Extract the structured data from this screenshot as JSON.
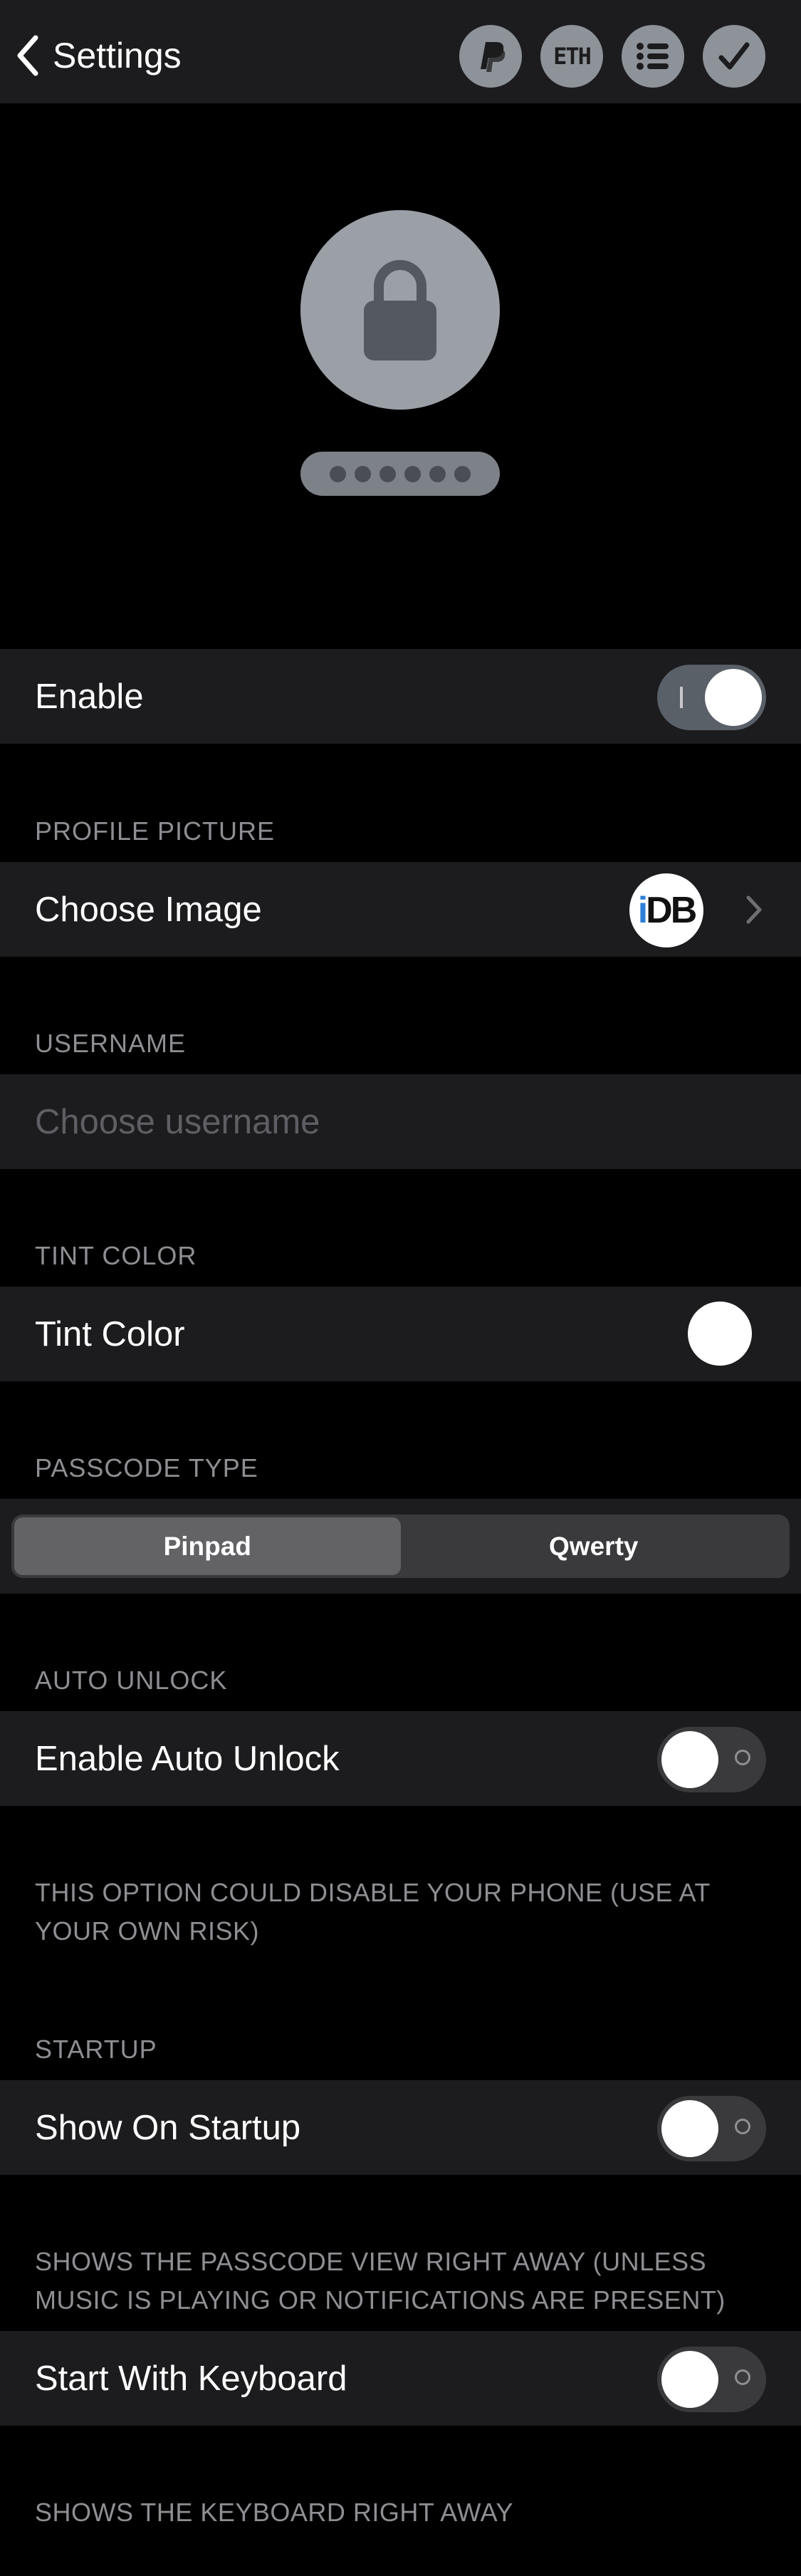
{
  "navbar": {
    "back_label": "Settings",
    "icons": [
      "paypal-icon",
      "eth-icon",
      "list-icon",
      "checkmark-icon"
    ],
    "eth_text": "ETH"
  },
  "hero": {
    "icon": "lock-icon",
    "passcode_dot_count": 6
  },
  "enable": {
    "label": "Enable",
    "on": true
  },
  "profile_picture": {
    "header": "PROFILE PICTURE",
    "label": "Choose Image",
    "avatar_text_i": "i",
    "avatar_text_db": "DB"
  },
  "username": {
    "header": "USERNAME",
    "placeholder": "Choose username",
    "value": ""
  },
  "tint": {
    "header": "TINT COLOR",
    "label": "Tint Color",
    "color": "#ffffff"
  },
  "passcode_type": {
    "header": "PASSCODE TYPE",
    "options": [
      "Pinpad",
      "Qwerty"
    ],
    "selected": "Pinpad"
  },
  "auto_unlock": {
    "header": "AUTO UNLOCK",
    "label": "Enable Auto Unlock",
    "on": false,
    "footer": "THIS OPTION COULD DISABLE YOUR PHONE (USE AT YOUR OWN RISK)"
  },
  "startup": {
    "header": "STARTUP",
    "show_label": "Show On Startup",
    "show_on": false,
    "show_footer": "SHOWS THE PASSCODE VIEW RIGHT AWAY (UNLESS MUSIC IS PLAYING OR NOTIFICATIONS ARE PRESENT)",
    "keyboard_label": "Start With Keyboard",
    "keyboard_on": false,
    "keyboard_footer": "SHOWS THE KEYBOARD RIGHT AWAY"
  },
  "colors": {
    "background": "#000000",
    "cell": "#1c1c1e",
    "secondary_text": "#8e8e93",
    "icon_gray": "#8e9399"
  }
}
